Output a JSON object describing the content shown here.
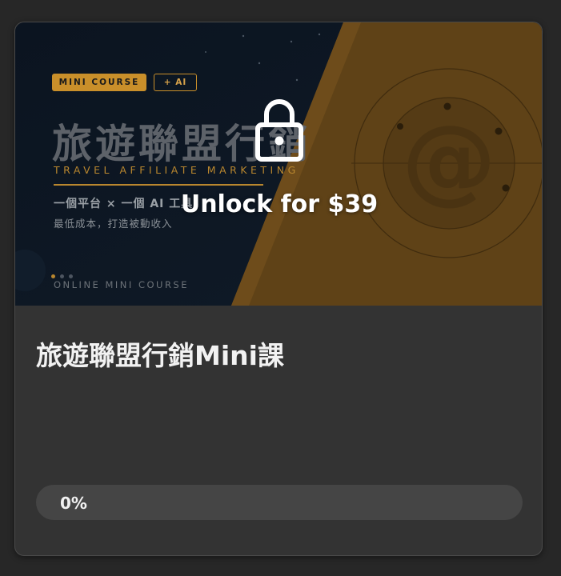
{
  "course": {
    "title": "旅遊聯盟行銷Mini課",
    "unlock_label": "Unlock for $39",
    "progress_text": "0%",
    "progress_fraction": 0
  },
  "thumbnail": {
    "badge_course": "MINI COURSE",
    "badge_ai": "+ AI",
    "title": "旅遊聯盟行銷",
    "subtitle": "TRAVEL AFFILIATE MARKETING",
    "tagline": "一個平台 × 一個 AI 工具",
    "tagline2": "最低成本，打造被動收入",
    "footer": "ONLINE MINI COURSE",
    "symbol": "@"
  },
  "colors": {
    "accent": "#c98f2a",
    "navy": "#0d1622",
    "card": "#333333",
    "background": "#272727"
  },
  "icons": {
    "lock": "lock-icon"
  }
}
